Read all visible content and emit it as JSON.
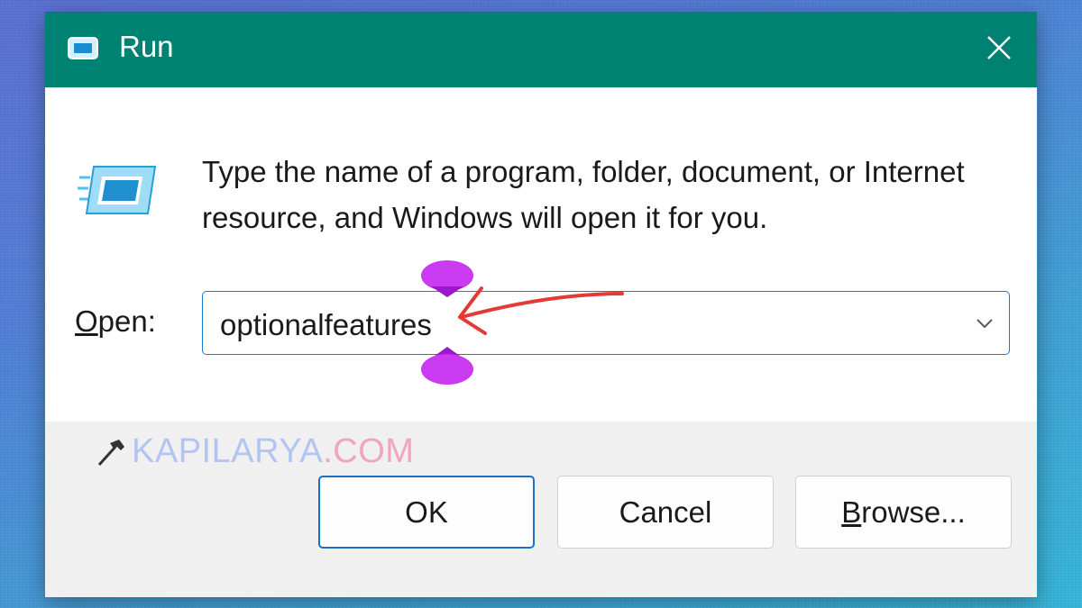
{
  "window": {
    "title": "Run",
    "close_icon": "close-icon",
    "title_icon": "run-icon"
  },
  "body": {
    "description": "Type the name of a program, folder, document, or Internet resource, and Windows will open it for you.",
    "open_label_accel": "O",
    "open_label_rest": "pen:",
    "open_value": "optionalfeatures",
    "dropdown_icon": "chevron-down-icon"
  },
  "watermark": {
    "icon": "hammer-icon",
    "part1": "KAPILARYA",
    "part2": ".COM"
  },
  "buttons": {
    "ok": "OK",
    "cancel": "Cancel",
    "browse_accel": "B",
    "browse_rest": "rowse..."
  },
  "colors": {
    "titlebar": "#008272",
    "accent_border": "#1b7bd1",
    "annotation_arrow": "#e53935",
    "annotation_marker": "#c040f0"
  }
}
